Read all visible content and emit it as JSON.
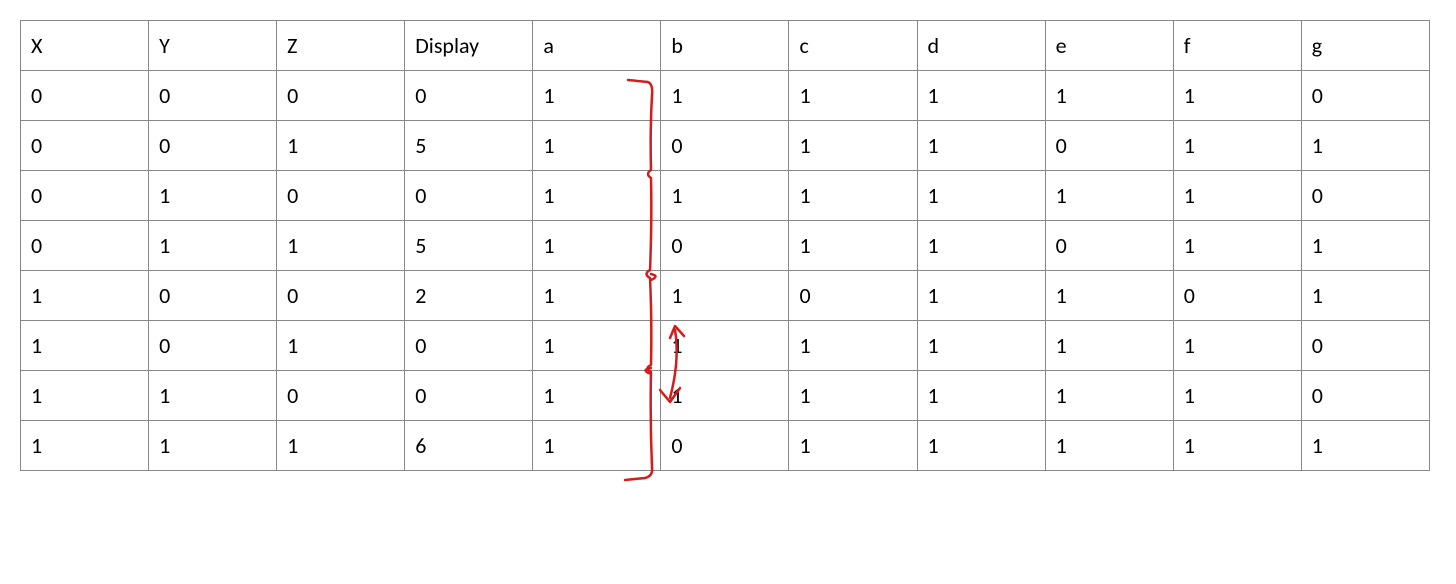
{
  "table": {
    "headers": [
      "X",
      "Y",
      "Z",
      "Display",
      "a",
      "b",
      "c",
      "d",
      "e",
      "f",
      "g"
    ],
    "rows": [
      [
        "0",
        "0",
        "0",
        "0",
        "1",
        "1",
        "1",
        "1",
        "1",
        "1",
        "0"
      ],
      [
        "0",
        "0",
        "1",
        "5",
        "1",
        "0",
        "1",
        "1",
        "0",
        "1",
        "1"
      ],
      [
        "0",
        "1",
        "0",
        "0",
        "1",
        "1",
        "1",
        "1",
        "1",
        "1",
        "0"
      ],
      [
        "0",
        "1",
        "1",
        "5",
        "1",
        "0",
        "1",
        "1",
        "0",
        "1",
        "1"
      ],
      [
        "1",
        "0",
        "0",
        "2",
        "1",
        "1",
        "0",
        "1",
        "1",
        "0",
        "1"
      ],
      [
        "1",
        "0",
        "1",
        "0",
        "1",
        "1",
        "1",
        "1",
        "1",
        "1",
        "0"
      ],
      [
        "1",
        "1",
        "0",
        "0",
        "1",
        "1",
        "1",
        "1",
        "1",
        "1",
        "0"
      ],
      [
        "1",
        "1",
        "1",
        "6",
        "1",
        "0",
        "1",
        "1",
        "1",
        "1",
        "1"
      ]
    ]
  }
}
